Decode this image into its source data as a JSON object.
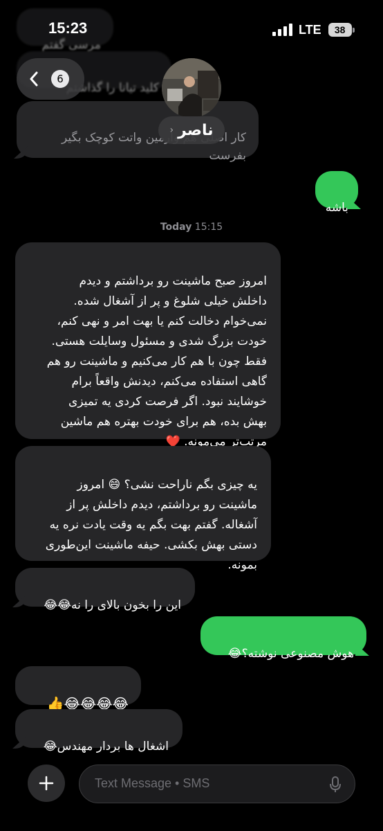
{
  "status_bar": {
    "time": "15:23",
    "network": "LTE",
    "battery": "38"
  },
  "header": {
    "back_count": "6",
    "contact_name": "ناصر"
  },
  "earlier_messages": [
    {
      "text": "مرسی گفتم"
    },
    {
      "text": "کلید تیانا را گذاشتم"
    },
    {
      "text": "کار اصلی هم وارمین واتت کوچک بگیر\nبفرست"
    }
  ],
  "messages": [
    {
      "direction": "out",
      "text": "باشه"
    },
    {
      "direction": "timestamp",
      "day": "Today",
      "time": "15:15"
    },
    {
      "direction": "in",
      "text": "امروز صبح ماشینت رو برداشتم و دیدم\nداخلش خیلی شلوغ و پر از آشغال شده.\nنمی‌خوام دخالت کنم یا بهت امر و نهی کنم،\nخودت بزرگ شدی و مسئول وسایلت هستی.\nفقط چون با هم کار می‌کنیم و ماشینت رو هم\nگاهی استفاده می‌کنم، دیدنش واقعاً برام\nخوشایند نبود. اگر فرصت کردی یه تمیزی\nبهش بده، هم برای خودت بهتره هم ماشین\nمرتب‌تر می‌مونه. ❤️"
    },
    {
      "direction": "in",
      "text": "یه چیزی بگم ناراحت نشی؟ 😄 امروز\nماشینت رو برداشتم، دیدم داخلش پر از\nآشغاله. گفتم بهت بگم یه وقت یادت نره یه\nدستی بهش بکشی. حیفه ماشینت این‌طوری\nبمونه."
    },
    {
      "direction": "in",
      "text": "این را بخون بالای را نه😂😂"
    },
    {
      "direction": "out",
      "text": "هوش مصنوعی نوشته؟😂"
    },
    {
      "direction": "in",
      "text": "😂😂😂😂👍"
    },
    {
      "direction": "in",
      "text": "اشغال ها بردار مهندس😂"
    }
  ],
  "composer": {
    "placeholder": "Text Message • SMS"
  },
  "icons": [
    "chevron-left-icon",
    "signal-icon",
    "battery-icon",
    "plus-icon",
    "microphone-icon"
  ],
  "colors": {
    "background": "#000000",
    "incoming_bubble": "#262628",
    "outgoing_bubble": "#34c759"
  }
}
